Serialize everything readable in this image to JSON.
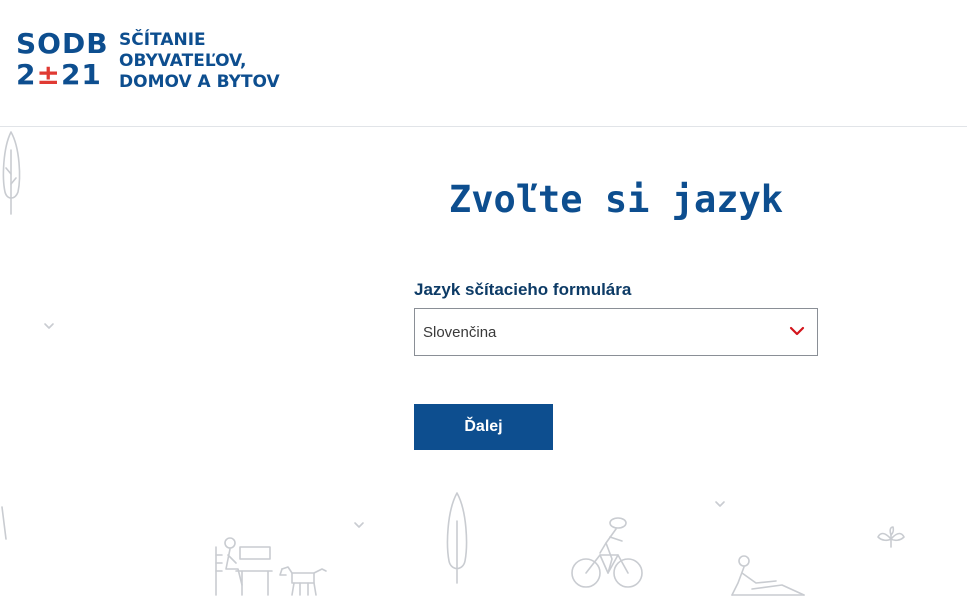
{
  "logo": {
    "mark_top": "SODB",
    "mark_bottom_left": "2",
    "mark_bottom_symbol": "±",
    "mark_bottom_right": "21",
    "text_lines": [
      "SČÍTANIE",
      "OBYVATEĽOV,",
      "DOMOV A BYTOV"
    ]
  },
  "main": {
    "title": "Zvoľte si jazyk",
    "language_field": {
      "label": "Jazyk sčítacieho formulára",
      "selected": "Slovenčina"
    },
    "next_button_label": "Ďalej"
  },
  "colors": {
    "brand_blue": "#0d4e8f",
    "brand_red": "#e03a33",
    "decoration_gray": "#c9ccd1"
  },
  "icons": {
    "select": "chevron-down-icon",
    "decorations": [
      "tree-icon",
      "chevron-down-icon",
      "person-on-bench-icon",
      "dog-icon",
      "cyclist-icon",
      "person-reclining-icon",
      "plant-icon"
    ]
  }
}
